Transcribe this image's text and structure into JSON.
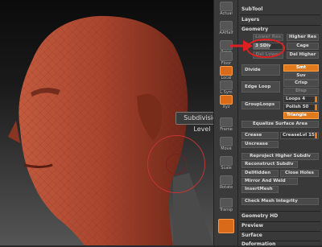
{
  "shelf": {
    "items": [
      {
        "label": "Actual",
        "orange": false
      },
      {
        "label": "AAHalf",
        "orange": false
      },
      {
        "label": "Persp",
        "orange": false
      },
      {
        "label": "Floor",
        "orange": false
      },
      {
        "label": "Local",
        "orange": true
      },
      {
        "label": "L.Sym",
        "orange": false
      },
      {
        "label": "Xyz",
        "orange": true
      },
      {
        "label": "Frame",
        "orange": false
      },
      {
        "label": "Move",
        "orange": false
      },
      {
        "label": "Scale",
        "orange": false
      },
      {
        "label": "Rotate",
        "orange": false
      },
      {
        "label": "Transp",
        "orange": false
      }
    ]
  },
  "tooltip": "Subdivision Level",
  "panel": {
    "subtool": "SubTool",
    "layers": "Layers",
    "geometry": "Geometry",
    "lower_res": "Lower Res",
    "higher_res": "Higher Res",
    "sdiv_label": "SDiv",
    "sdiv_value": "3",
    "cage": "Cage",
    "del_lower": "Del Lower",
    "del_higher": "Del Higher",
    "divide": "Divide",
    "smt": "Smt",
    "suv": "Suv",
    "edge_loop": "Edge Loop",
    "crisp": "Crisp",
    "disp": "Disp",
    "loops_label": "Loops",
    "loops_value": "4",
    "grouploops": "GroupLoops",
    "polish_label": "Polish",
    "polish_value": "50",
    "triangle": "Triangle",
    "equalize": "Equalize Surface Area",
    "crease": "Crease",
    "creaselvl_label": "CreaseLvl",
    "creaselvl_value": "15",
    "uncrease": "Uncrease",
    "reproject": "Reproject Higher Subdiv",
    "reconstruct": "Reconstruct Subdiv",
    "delhidden": "DelHidden",
    "close_holes": "Close Holes",
    "mirror_weld": "Mirror And Weld",
    "insert_mesh": "InsertMesh",
    "check_mesh": "Check Mesh Integrity",
    "geometry_hd": "Geometry HD",
    "preview": "Preview",
    "surface": "Surface",
    "deformation": "Deformation"
  },
  "colors": {
    "accent": "#e07a1c",
    "highlight": "#e02020",
    "head": "#a8442e"
  }
}
